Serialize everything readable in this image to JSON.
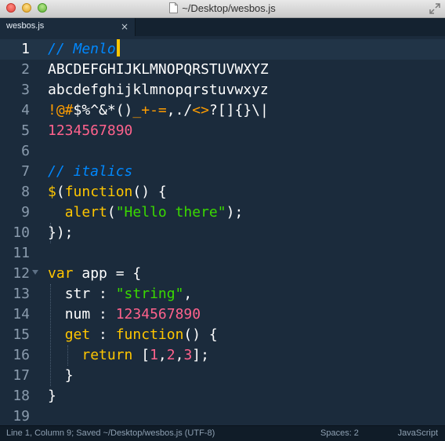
{
  "window": {
    "title": "~/Desktop/wesbos.js"
  },
  "tabs": [
    {
      "label": "wesbos.js",
      "close_glyph": "×"
    }
  ],
  "editor": {
    "active_line": 1,
    "line_numbers": [
      "1",
      "2",
      "3",
      "4",
      "5",
      "6",
      "7",
      "8",
      "9",
      "10",
      "11",
      "12",
      "13",
      "14",
      "15",
      "16",
      "17",
      "18",
      "19"
    ],
    "theme_colors": {
      "background": "#1b2b3c",
      "comment": "#0088ff",
      "keyword": "#ffc600",
      "string": "#3ad900",
      "number": "#ff628c",
      "caret": "#ffc600"
    },
    "lines": {
      "l1": {
        "comment": "// Menlo"
      },
      "l2": {
        "text": "ABCDEFGHIJKLMNOPQRSTUVWXYZ"
      },
      "l3": {
        "text": "abcdefghijklmnopqrstuvwxyz"
      },
      "l4": {
        "a": "!@#",
        "b": "$%^&*",
        "c": "()",
        "d": "_+-=",
        "e": ",./",
        "f": "<>",
        "g": "?[]{}\\|"
      },
      "l5": {
        "number": "1234567890"
      },
      "l6": {
        "text": ""
      },
      "l7": {
        "comment": "// italics"
      },
      "l8": {
        "a": "$",
        "b": "(",
        "c": "function",
        "d": "() {"
      },
      "l9": {
        "indent": "  ",
        "fn": "alert",
        "open": "(",
        "str": "\"Hello there\"",
        "close": ");"
      },
      "l10": {
        "text": "});"
      },
      "l11": {
        "text": ""
      },
      "l12": {
        "kw": "var",
        "rest": " app = {"
      },
      "l13": {
        "indent": "  ",
        "key": "str : ",
        "str": "\"string\"",
        "end": ","
      },
      "l14": {
        "indent": "  ",
        "key": "num : ",
        "num": "1234567890"
      },
      "l15": {
        "indent": "  ",
        "kw": "get",
        "mid": " : ",
        "fn": "function",
        "end": "() {"
      },
      "l16": {
        "indent": "    ",
        "kw": "return",
        "open": " [",
        "n1": "1",
        "c1": ",",
        "n2": "2",
        "c2": ",",
        "n3": "3",
        "close": "];"
      },
      "l17": {
        "indent": "  ",
        "text": "}"
      },
      "l18": {
        "text": "}"
      },
      "l19": {
        "text": ""
      }
    }
  },
  "status": {
    "left": "Line 1, Column 9; Saved ~/Desktop/wesbos.js (UTF-8)",
    "spaces": "Spaces: 2",
    "syntax": "JavaScript"
  },
  "icons": [
    "close-window-icon",
    "minimize-window-icon",
    "zoom-window-icon",
    "document-icon",
    "fullscreen-icon",
    "fold-arrow-icon"
  ]
}
